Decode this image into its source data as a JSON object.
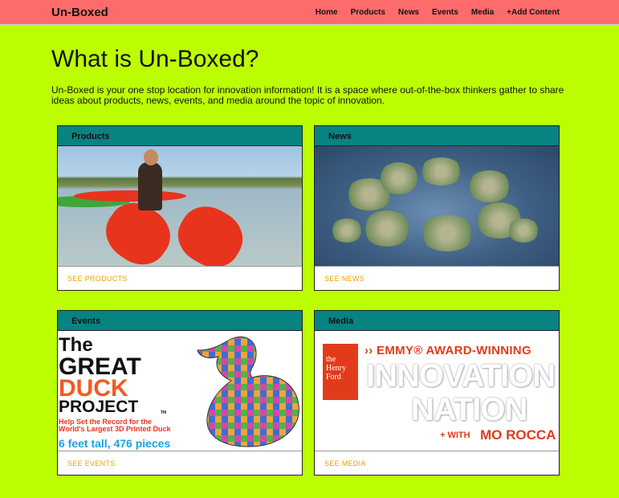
{
  "navbar": {
    "brand": "Un-Boxed",
    "links": [
      "Home",
      "Products",
      "News",
      "Events",
      "Media",
      "+Add Content"
    ]
  },
  "hero": {
    "title": "What is Un-Boxed?",
    "intro": "Un-Boxed is your one stop location for innovation information! It is a space where out-of-the-box thinkers gather to share ideas about products, news, events, and media around the topic of innovation."
  },
  "cards": [
    {
      "title": "Products",
      "link": "SEE PRODUCTS"
    },
    {
      "title": "News",
      "link": "SEE NEWS"
    },
    {
      "title": "Events",
      "link": "SEE EVENTS"
    },
    {
      "title": "Media",
      "link": "SEE MEDIA"
    }
  ],
  "events_image": {
    "line1": "The",
    "line2": "GREAT",
    "line3": "DUCK",
    "line4": "PROJECT",
    "tm": "TM",
    "sub1": "Help Set the Record for the",
    "sub2": "World's Largest 3D Printed Duck",
    "sub3": "6 feet tall, 476 pieces"
  },
  "media_image": {
    "logo_line1": "the",
    "logo_line2": "Henry",
    "logo_line3": "Ford",
    "emmy": "›› EMMY® AWARD-WINNING",
    "innovation": "INNOVATION",
    "nation": "NATION",
    "with": "+ WITH",
    "host": "MO ROCCA"
  },
  "colors": {
    "page_bg": "#bdfd02",
    "navbar_bg": "#fe6b6b",
    "card_header_bg": "#078381",
    "card_link": "#f0a000"
  }
}
